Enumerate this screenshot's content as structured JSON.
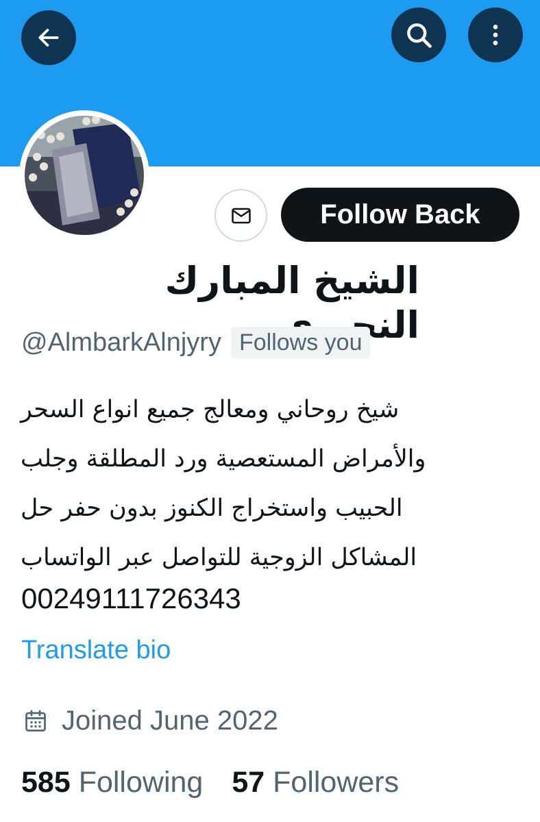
{
  "header": {
    "back_icon": "arrow-left-icon",
    "search_icon": "search-icon",
    "more_icon": "more-vertical-icon",
    "banner_color": "#1d9bf0"
  },
  "actions": {
    "message_icon": "envelope-icon",
    "follow_label": "Follow Back"
  },
  "profile": {
    "name": "الشيخ المبارك النجيري",
    "handle": "@AlmbarkAlnjyry",
    "follows_you": "Follows you",
    "bio_lines": [
      "شيخ روحاني ومعالج جميع انواع السحر",
      "والأمراض المستعصية ورد المطلقة وجلب",
      "الحبيب واستخراج الكنوز بدون حفر حل",
      "المشاكل الزوجية  للتواصل عبر الواتساب"
    ],
    "phone": "00249111726343",
    "translate_label": "Translate bio",
    "joined": "Joined June 2022",
    "calendar_icon": "calendar-icon"
  },
  "stats": {
    "following_count": "585",
    "following_label": "Following",
    "followers_count": "57",
    "followers_label": "Followers"
  }
}
